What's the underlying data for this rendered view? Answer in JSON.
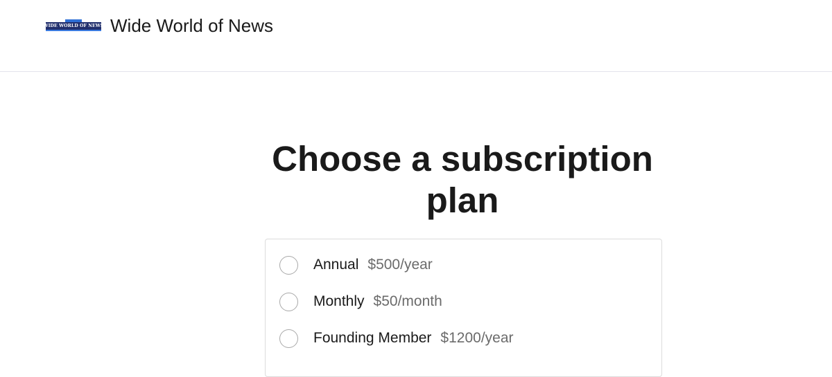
{
  "header": {
    "logo_text": "WIDE WORLD OF NEWS",
    "site_title": "Wide World of News",
    "logo_colors": {
      "bar": "#22306e",
      "accent": "#2f6fd6"
    }
  },
  "main": {
    "title": "Choose a subscription plan",
    "plans": [
      {
        "name": "Annual",
        "price": "$500/year",
        "selected": false
      },
      {
        "name": "Monthly",
        "price": "$50/month",
        "selected": false
      },
      {
        "name": "Founding Member",
        "price": "$1200/year",
        "selected": false
      }
    ]
  }
}
